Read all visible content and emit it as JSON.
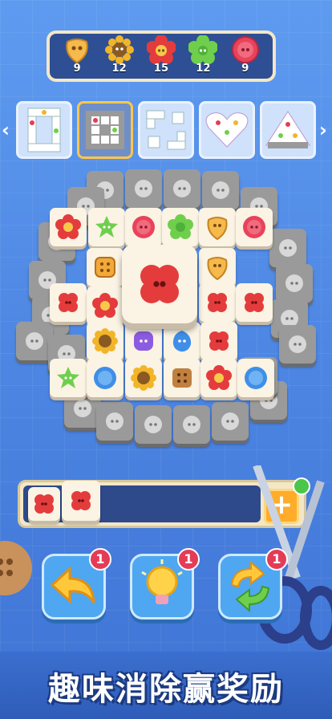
{
  "goals": [
    {
      "icon": "yellow-button-icon",
      "count": "9",
      "color": "#f6b94c"
    },
    {
      "icon": "sunflower-button-icon",
      "count": "12",
      "color": "#f2b529"
    },
    {
      "icon": "red-flower-button-icon",
      "count": "15",
      "color": "#e43c3c"
    },
    {
      "icon": "green-flower-button-icon",
      "count": "12",
      "color": "#6fcf4d"
    },
    {
      "icon": "pink-button-icon",
      "count": "9",
      "color": "#e8435b"
    }
  ],
  "levels": [
    "level-pattern-1",
    "level-pattern-2",
    "level-pattern-3",
    "level-pattern-heart",
    "level-pattern-5"
  ],
  "selected_level": 1,
  "tray": {
    "add_label": "+"
  },
  "actions": [
    {
      "name": "undo",
      "badge": "1"
    },
    {
      "name": "hint",
      "badge": "1"
    },
    {
      "name": "shuffle",
      "badge": "1"
    }
  ],
  "banner": "趣味消除赢奖励"
}
